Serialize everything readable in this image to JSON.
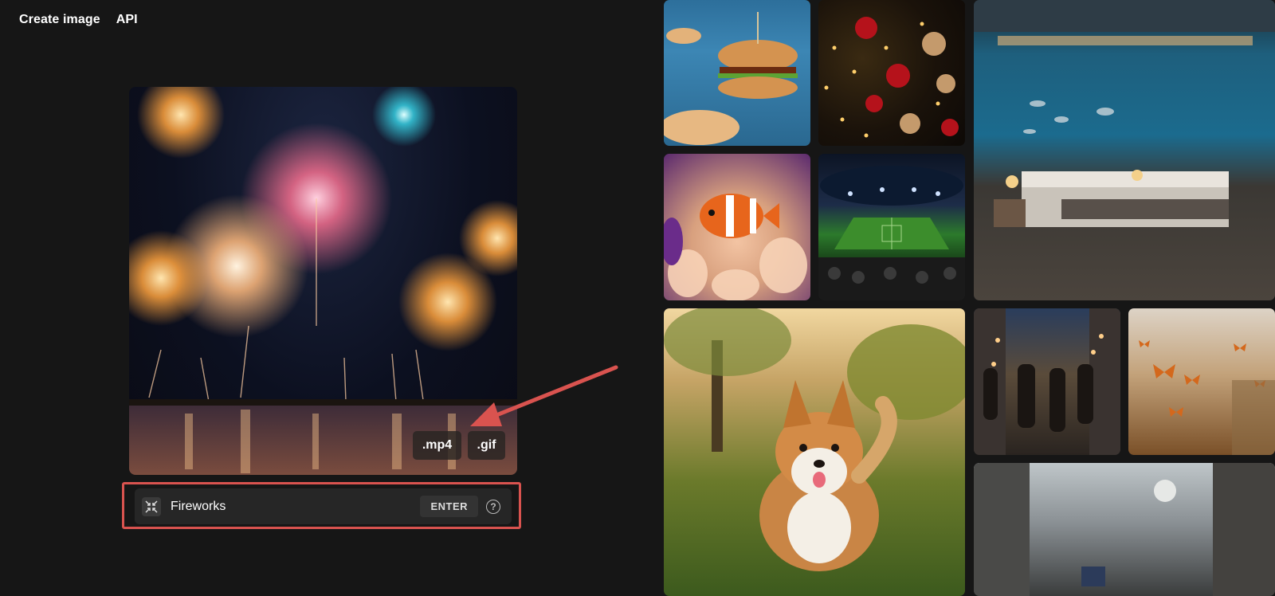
{
  "nav": {
    "create_image": "Create image",
    "api": "API"
  },
  "preview": {
    "format_buttons": {
      "mp4": ".mp4",
      "gif": ".gif"
    }
  },
  "prompt": {
    "value": "Fireworks",
    "enter_label": "ENTER",
    "help_glyph": "?",
    "collapse_icon": "collapse-arrows-icon"
  },
  "annotation": {
    "color": "#d9534f"
  },
  "gallery": {
    "tiles": [
      "burger",
      "christmas-tree",
      "underwater-bedroom",
      "clownfish",
      "stadium",
      "corgi",
      "city-street",
      "butterflies",
      "foggy-street"
    ]
  }
}
